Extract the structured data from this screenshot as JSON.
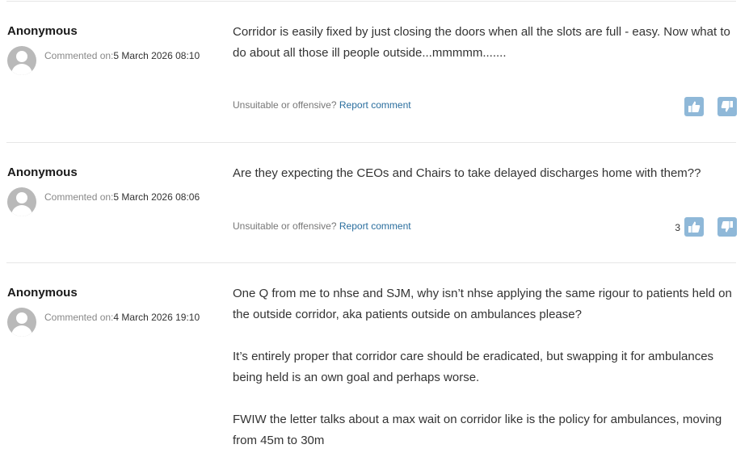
{
  "comments": [
    {
      "author": "Anonymous",
      "commented_on_label": "Commented on:",
      "date": "5 March 2026 08:10",
      "paragraphs": [
        "Corridor is easily fixed by just closing the doors when all the slots are full - easy. Now what to do about all those ill people outside...mmmmm......."
      ],
      "report_prompt": "Unsuitable or offensive?",
      "report_link": "Report comment",
      "like_count": ""
    },
    {
      "author": "Anonymous",
      "commented_on_label": "Commented on:",
      "date": "5 March 2026 08:06",
      "paragraphs": [
        "Are they expecting the CEOs and Chairs to take delayed discharges home with them??"
      ],
      "report_prompt": "Unsuitable or offensive?",
      "report_link": "Report comment",
      "like_count": "3"
    },
    {
      "author": "Anonymous",
      "commented_on_label": "Commented on:",
      "date": "4 March 2026 19:10",
      "paragraphs": [
        "One Q from me to nhse and SJM, why isn’t nhse applying the same rigour to patients held on the outside corridor, aka patients outside on ambulances please?",
        "It’s entirely proper that corridor care should be eradicated, but swapping it for ambulances being held is an own goal and perhaps worse.",
        "FWIW the letter talks about a max wait on corridor like is the policy for ambulances, moving from 45m to 30m"
      ]
    }
  ],
  "icons": {
    "like": "thumbs-up-icon",
    "dislike": "thumbs-down-icon",
    "avatar": "user-avatar-icon"
  },
  "colors": {
    "vote_button": "#8fb8d8",
    "link": "#2a6e9e"
  }
}
